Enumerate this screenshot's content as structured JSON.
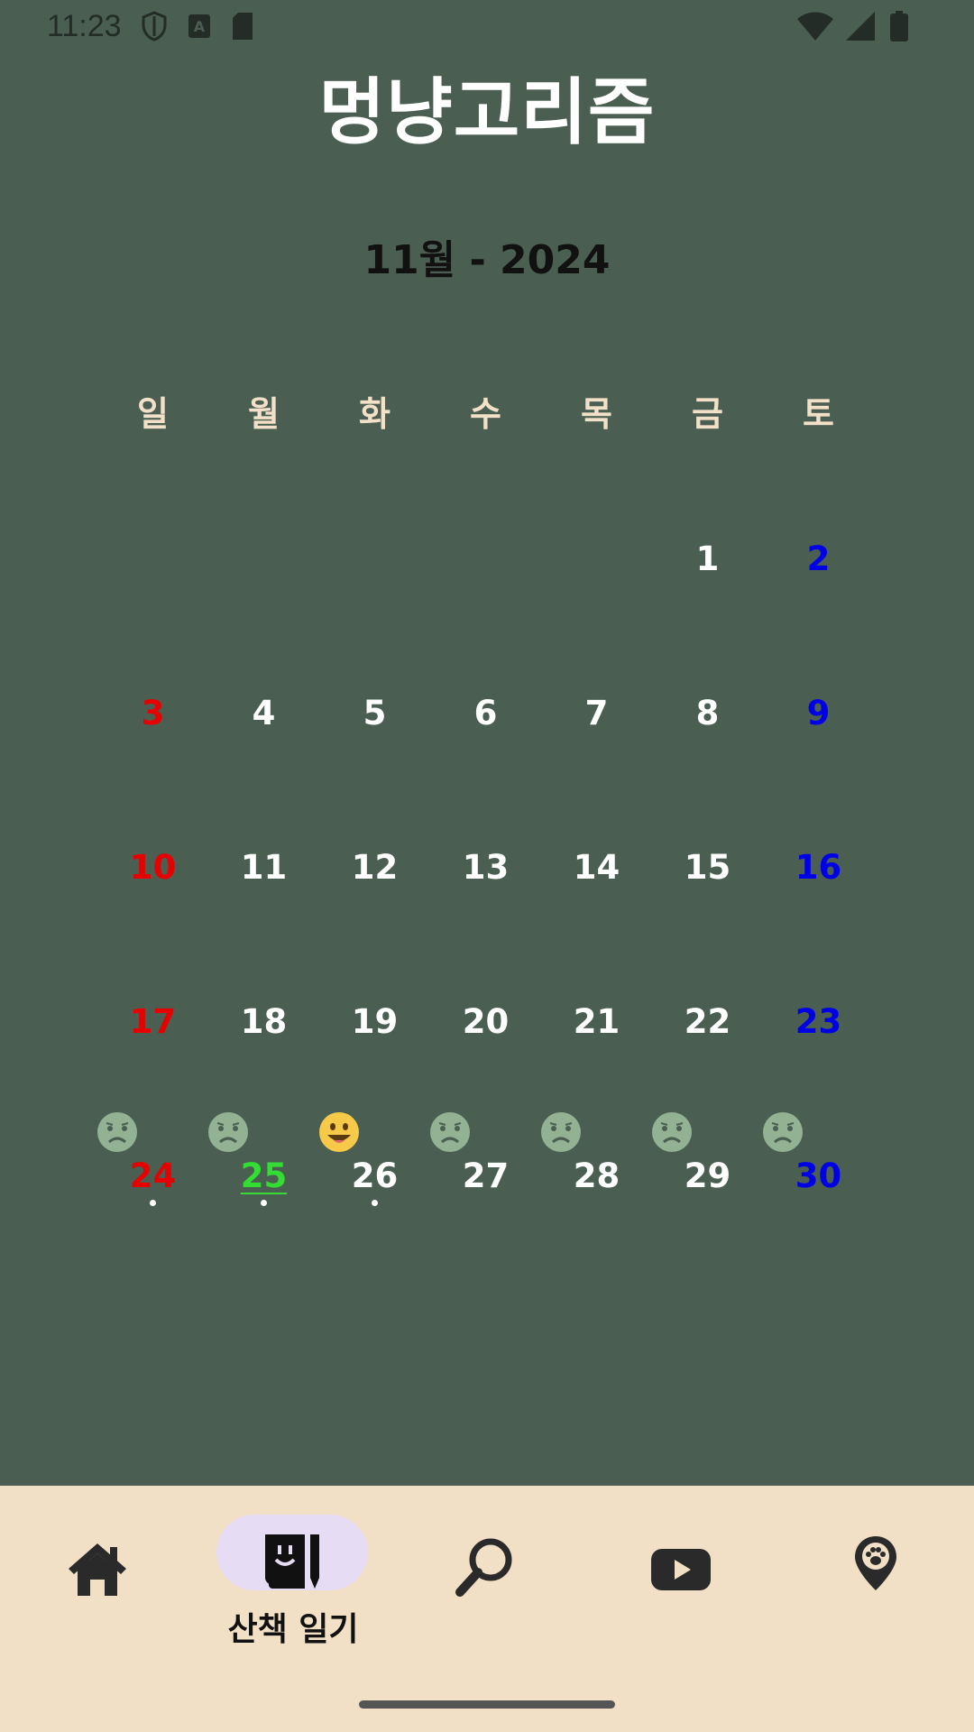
{
  "status_bar": {
    "time": "11:23"
  },
  "app": {
    "title": "멍냥고리즘"
  },
  "calendar": {
    "month_label": "11월 - 2024",
    "weekdays": [
      "일",
      "월",
      "화",
      "수",
      "목",
      "금",
      "토"
    ],
    "days": [
      {
        "day": "1",
        "weekday": 5,
        "week": 0
      },
      {
        "day": "2",
        "weekday": 6,
        "week": 0
      },
      {
        "day": "3",
        "weekday": 0,
        "week": 1
      },
      {
        "day": "4",
        "weekday": 1,
        "week": 1
      },
      {
        "day": "5",
        "weekday": 2,
        "week": 1
      },
      {
        "day": "6",
        "weekday": 3,
        "week": 1
      },
      {
        "day": "7",
        "weekday": 4,
        "week": 1
      },
      {
        "day": "8",
        "weekday": 5,
        "week": 1
      },
      {
        "day": "9",
        "weekday": 6,
        "week": 1
      },
      {
        "day": "10",
        "weekday": 0,
        "week": 2
      },
      {
        "day": "11",
        "weekday": 1,
        "week": 2
      },
      {
        "day": "12",
        "weekday": 2,
        "week": 2
      },
      {
        "day": "13",
        "weekday": 3,
        "week": 2
      },
      {
        "day": "14",
        "weekday": 4,
        "week": 2
      },
      {
        "day": "15",
        "weekday": 5,
        "week": 2
      },
      {
        "day": "16",
        "weekday": 6,
        "week": 2
      },
      {
        "day": "17",
        "weekday": 0,
        "week": 3
      },
      {
        "day": "18",
        "weekday": 1,
        "week": 3
      },
      {
        "day": "19",
        "weekday": 2,
        "week": 3
      },
      {
        "day": "20",
        "weekday": 3,
        "week": 3
      },
      {
        "day": "21",
        "weekday": 4,
        "week": 3
      },
      {
        "day": "22",
        "weekday": 5,
        "week": 3
      },
      {
        "day": "23",
        "weekday": 6,
        "week": 3
      },
      {
        "day": "24",
        "weekday": 0,
        "week": 4,
        "mood": "sad",
        "dot": true
      },
      {
        "day": "25",
        "weekday": 1,
        "week": 4,
        "mood": "sad",
        "dot": true,
        "today": true
      },
      {
        "day": "26",
        "weekday": 2,
        "week": 4,
        "mood": "happy",
        "dot": true
      },
      {
        "day": "27",
        "weekday": 3,
        "week": 4,
        "mood": "sad"
      },
      {
        "day": "28",
        "weekday": 4,
        "week": 4,
        "mood": "sad"
      },
      {
        "day": "29",
        "weekday": 5,
        "week": 4,
        "mood": "sad"
      },
      {
        "day": "30",
        "weekday": 6,
        "week": 4,
        "mood": "sad"
      }
    ]
  },
  "bottom_nav": {
    "items": [
      {
        "id": "home",
        "icon": "home-icon"
      },
      {
        "id": "walk-diary",
        "icon": "diary-icon",
        "label": "산책 일기",
        "active": true
      },
      {
        "id": "search",
        "icon": "search-icon"
      },
      {
        "id": "video",
        "icon": "youtube-icon"
      },
      {
        "id": "map",
        "icon": "paw-location-icon"
      }
    ]
  },
  "colors": {
    "background": "#4a5f52",
    "sunday": "#e60000",
    "saturday": "#0000e6",
    "today": "#33dd33",
    "nav_background": "#f2e0c6",
    "nav_active_pill": "#e6dcf4"
  }
}
